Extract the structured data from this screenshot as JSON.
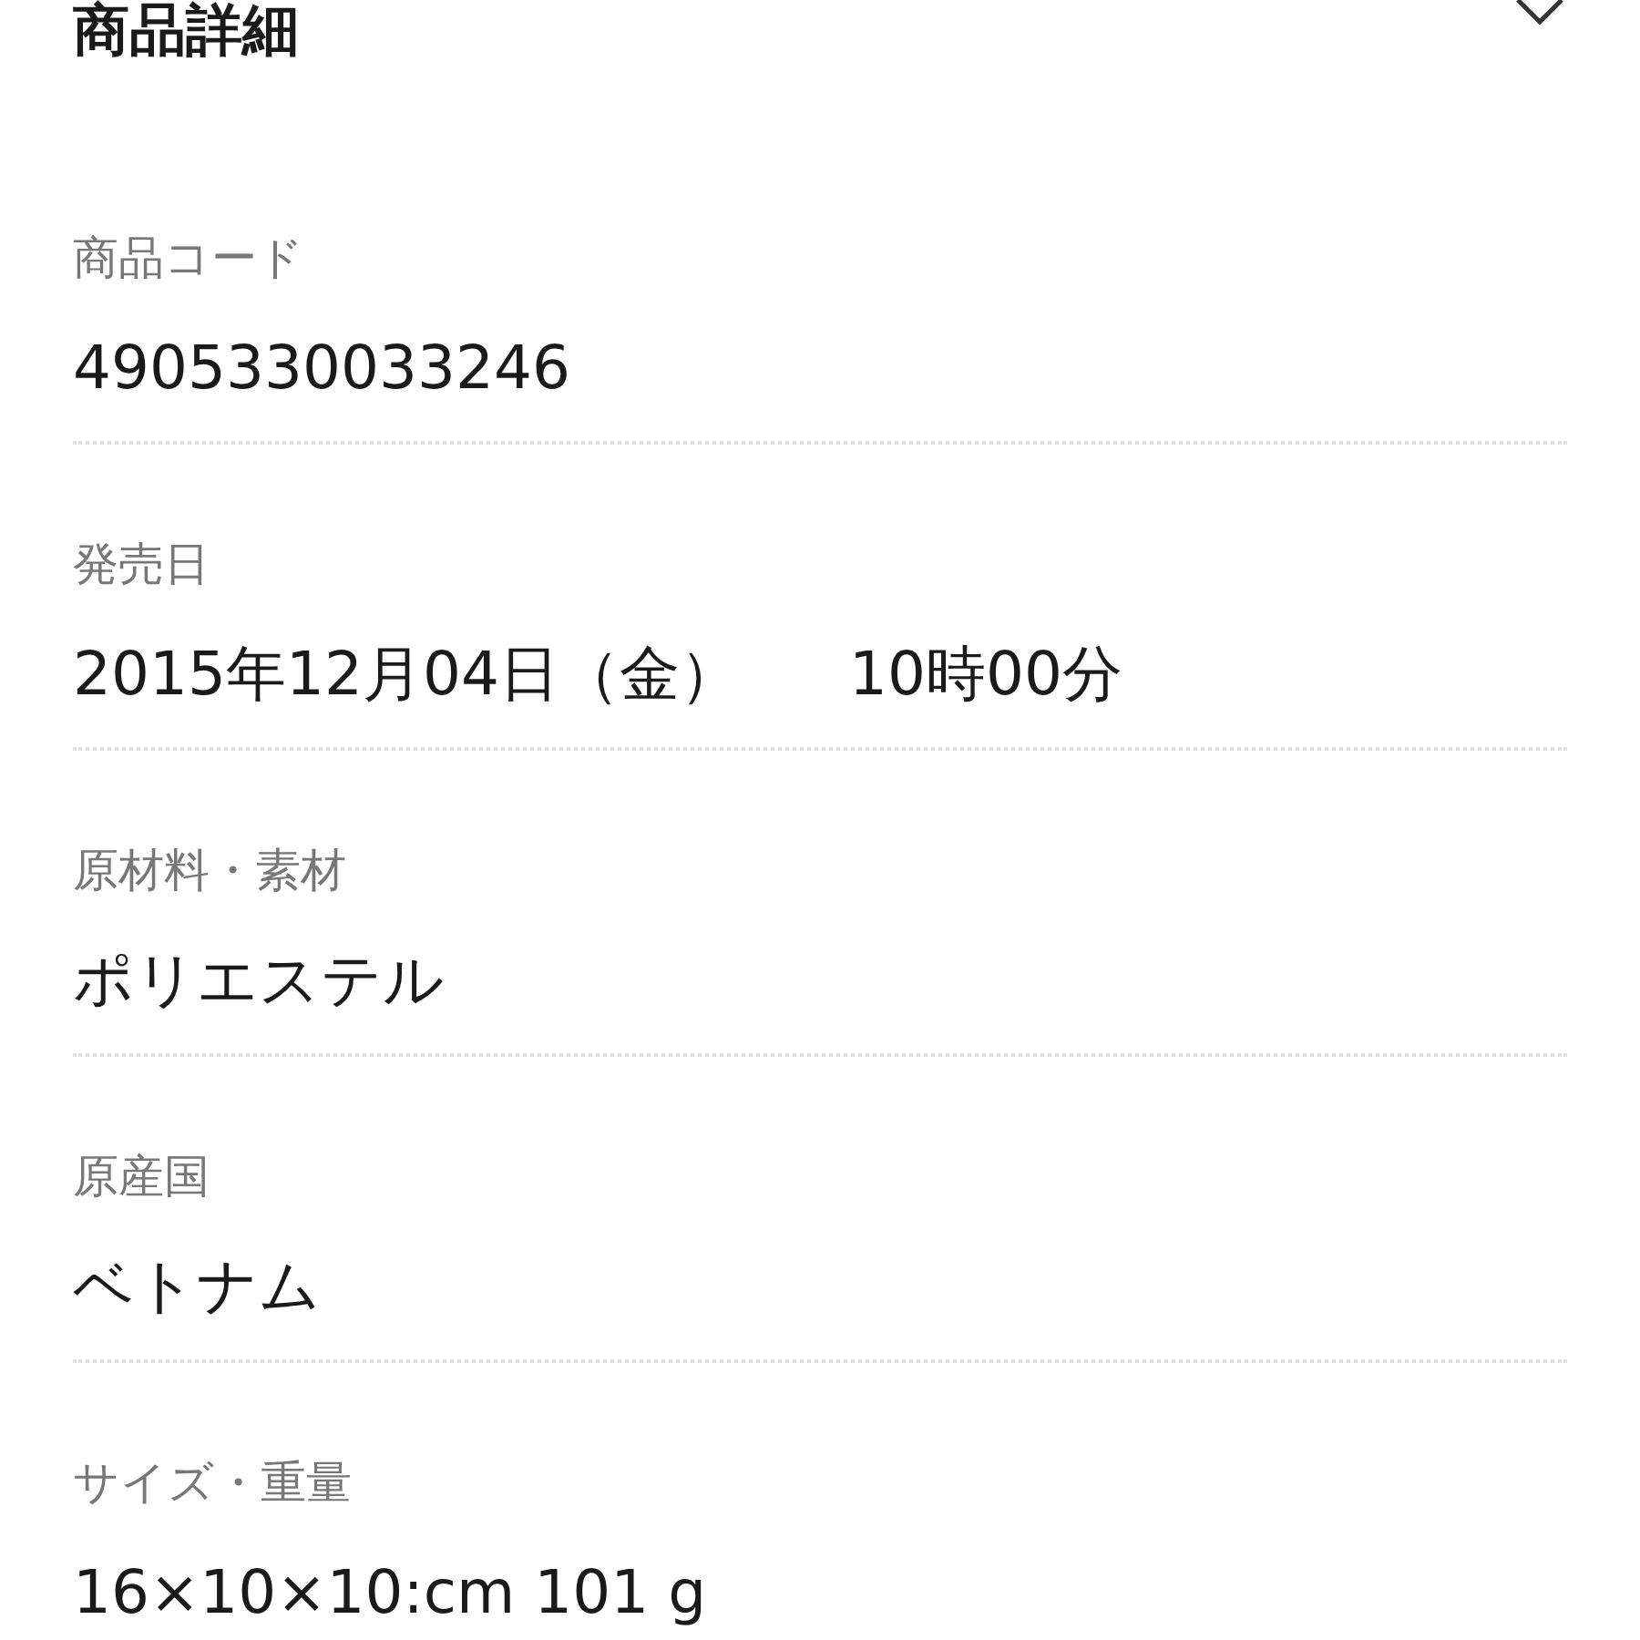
{
  "header": {
    "title": "商品詳細"
  },
  "fields": [
    {
      "label": "商品コード",
      "values": [
        "4905330033246"
      ]
    },
    {
      "label": "発売日",
      "values": [
        "2015年12月04日（金）",
        "10時00分"
      ]
    },
    {
      "label": "原材料・素材",
      "values": [
        "ポリエステル"
      ]
    },
    {
      "label": "原産国",
      "values": [
        "ベトナム"
      ]
    },
    {
      "label": "サイズ・重量",
      "values": [
        "16×10×10:cm 101 g"
      ]
    }
  ]
}
